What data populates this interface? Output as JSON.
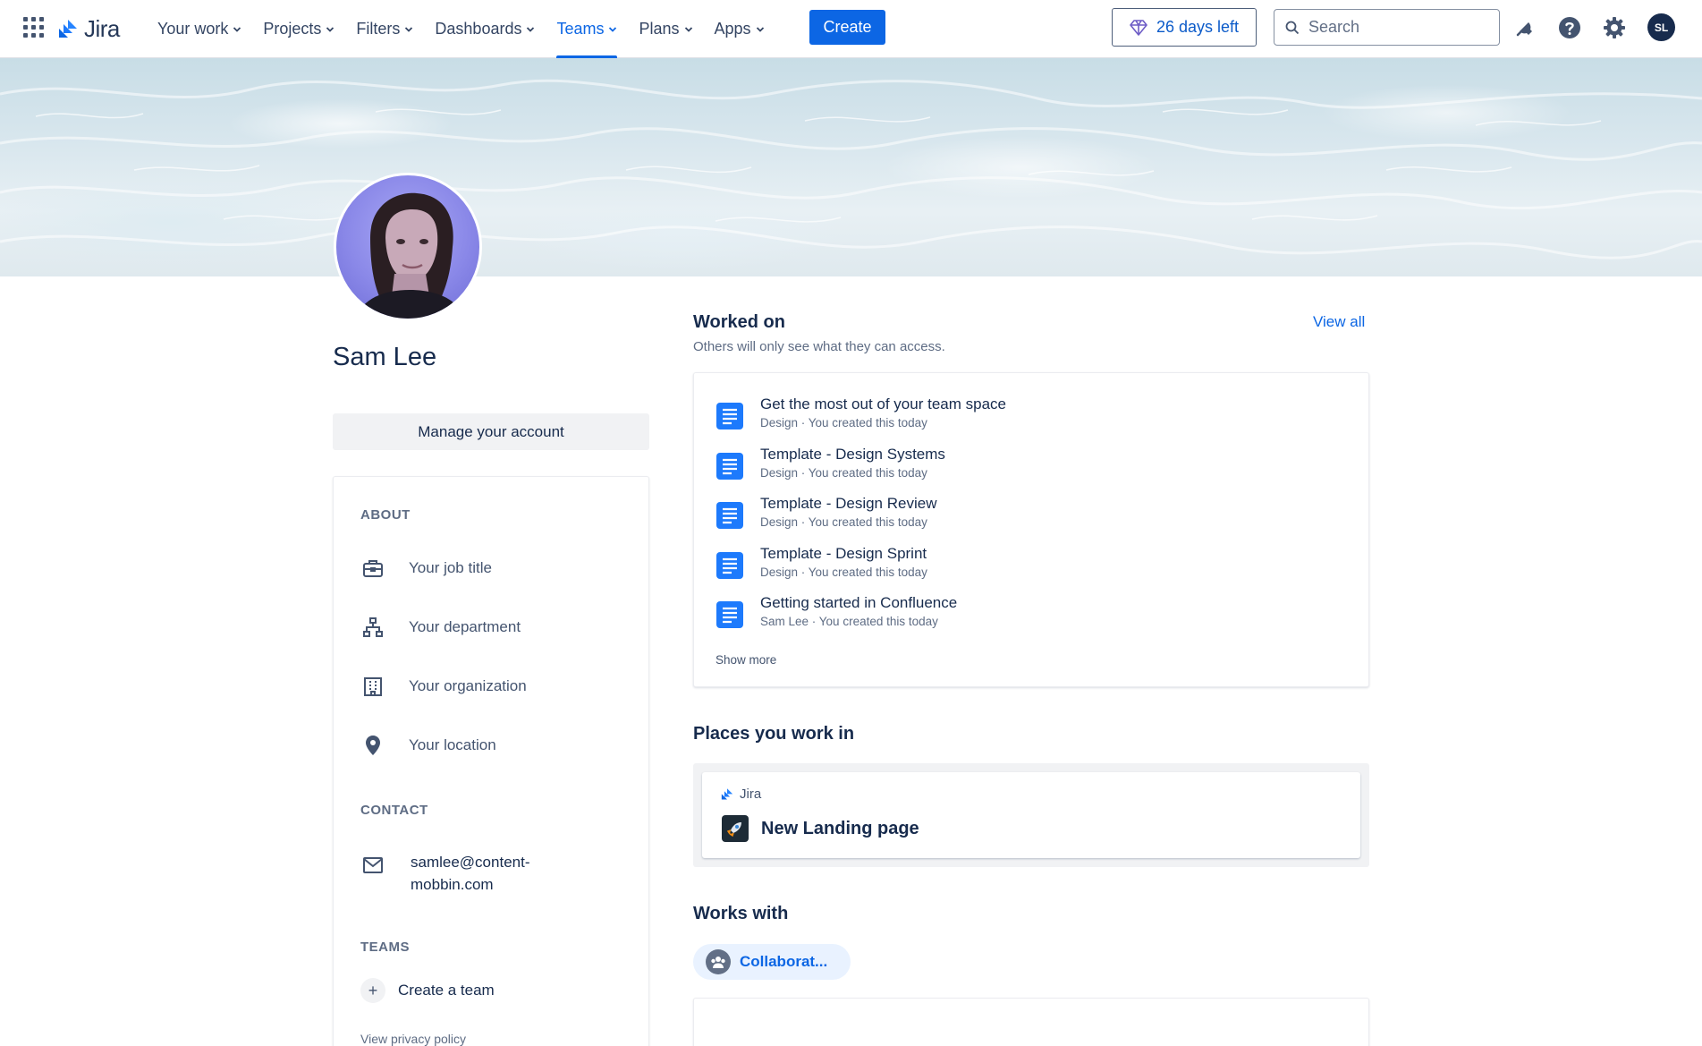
{
  "nav": {
    "logo_text": "Jira",
    "items": [
      {
        "label": "Your work",
        "active": false
      },
      {
        "label": "Projects",
        "active": false
      },
      {
        "label": "Filters",
        "active": false
      },
      {
        "label": "Dashboards",
        "active": false
      },
      {
        "label": "Teams",
        "active": true
      },
      {
        "label": "Plans",
        "active": false
      },
      {
        "label": "Apps",
        "active": false
      }
    ],
    "create_label": "Create",
    "trial_label": "26 days left",
    "search_placeholder": "Search",
    "user_initials": "SL",
    "icons": [
      "app-switcher-icon",
      "jira-logo-icon",
      "gem-icon",
      "search-icon",
      "notification-bell-icon",
      "help-icon",
      "settings-gear-icon"
    ]
  },
  "colors": {
    "primary": "#0c66e4",
    "text": "#172b4d",
    "subtle": "#5e6c84"
  },
  "profile": {
    "name": "Sam Lee",
    "manage_label": "Manage your account"
  },
  "about": {
    "heading": "ABOUT",
    "job_title": "Your job title",
    "department": "Your department",
    "organization": "Your organization",
    "location": "Your location",
    "contact_heading": "CONTACT",
    "email": "samlee@content-mobbin.com",
    "teams_heading": "TEAMS",
    "create_team": "Create a team",
    "privacy": "View privacy policy"
  },
  "worked_on": {
    "title": "Worked on",
    "subtitle": "Others will only see what they can access.",
    "view_all": "View all",
    "items": [
      {
        "title": "Get the most out of your team space",
        "meta": "Design · You created this today"
      },
      {
        "title": "Template - Design Systems",
        "meta": "Design · You created this today"
      },
      {
        "title": "Template - Design Review",
        "meta": "Design · You created this today"
      },
      {
        "title": "Template - Design Sprint",
        "meta": "Design · You created this today"
      },
      {
        "title": "Getting started in Confluence",
        "meta": "Sam Lee · You created this today"
      }
    ],
    "show_more": "Show more"
  },
  "places": {
    "title": "Places you work in",
    "app": "Jira",
    "project": "New Landing page"
  },
  "works_with": {
    "title": "Works with",
    "person": "Collaborat..."
  }
}
